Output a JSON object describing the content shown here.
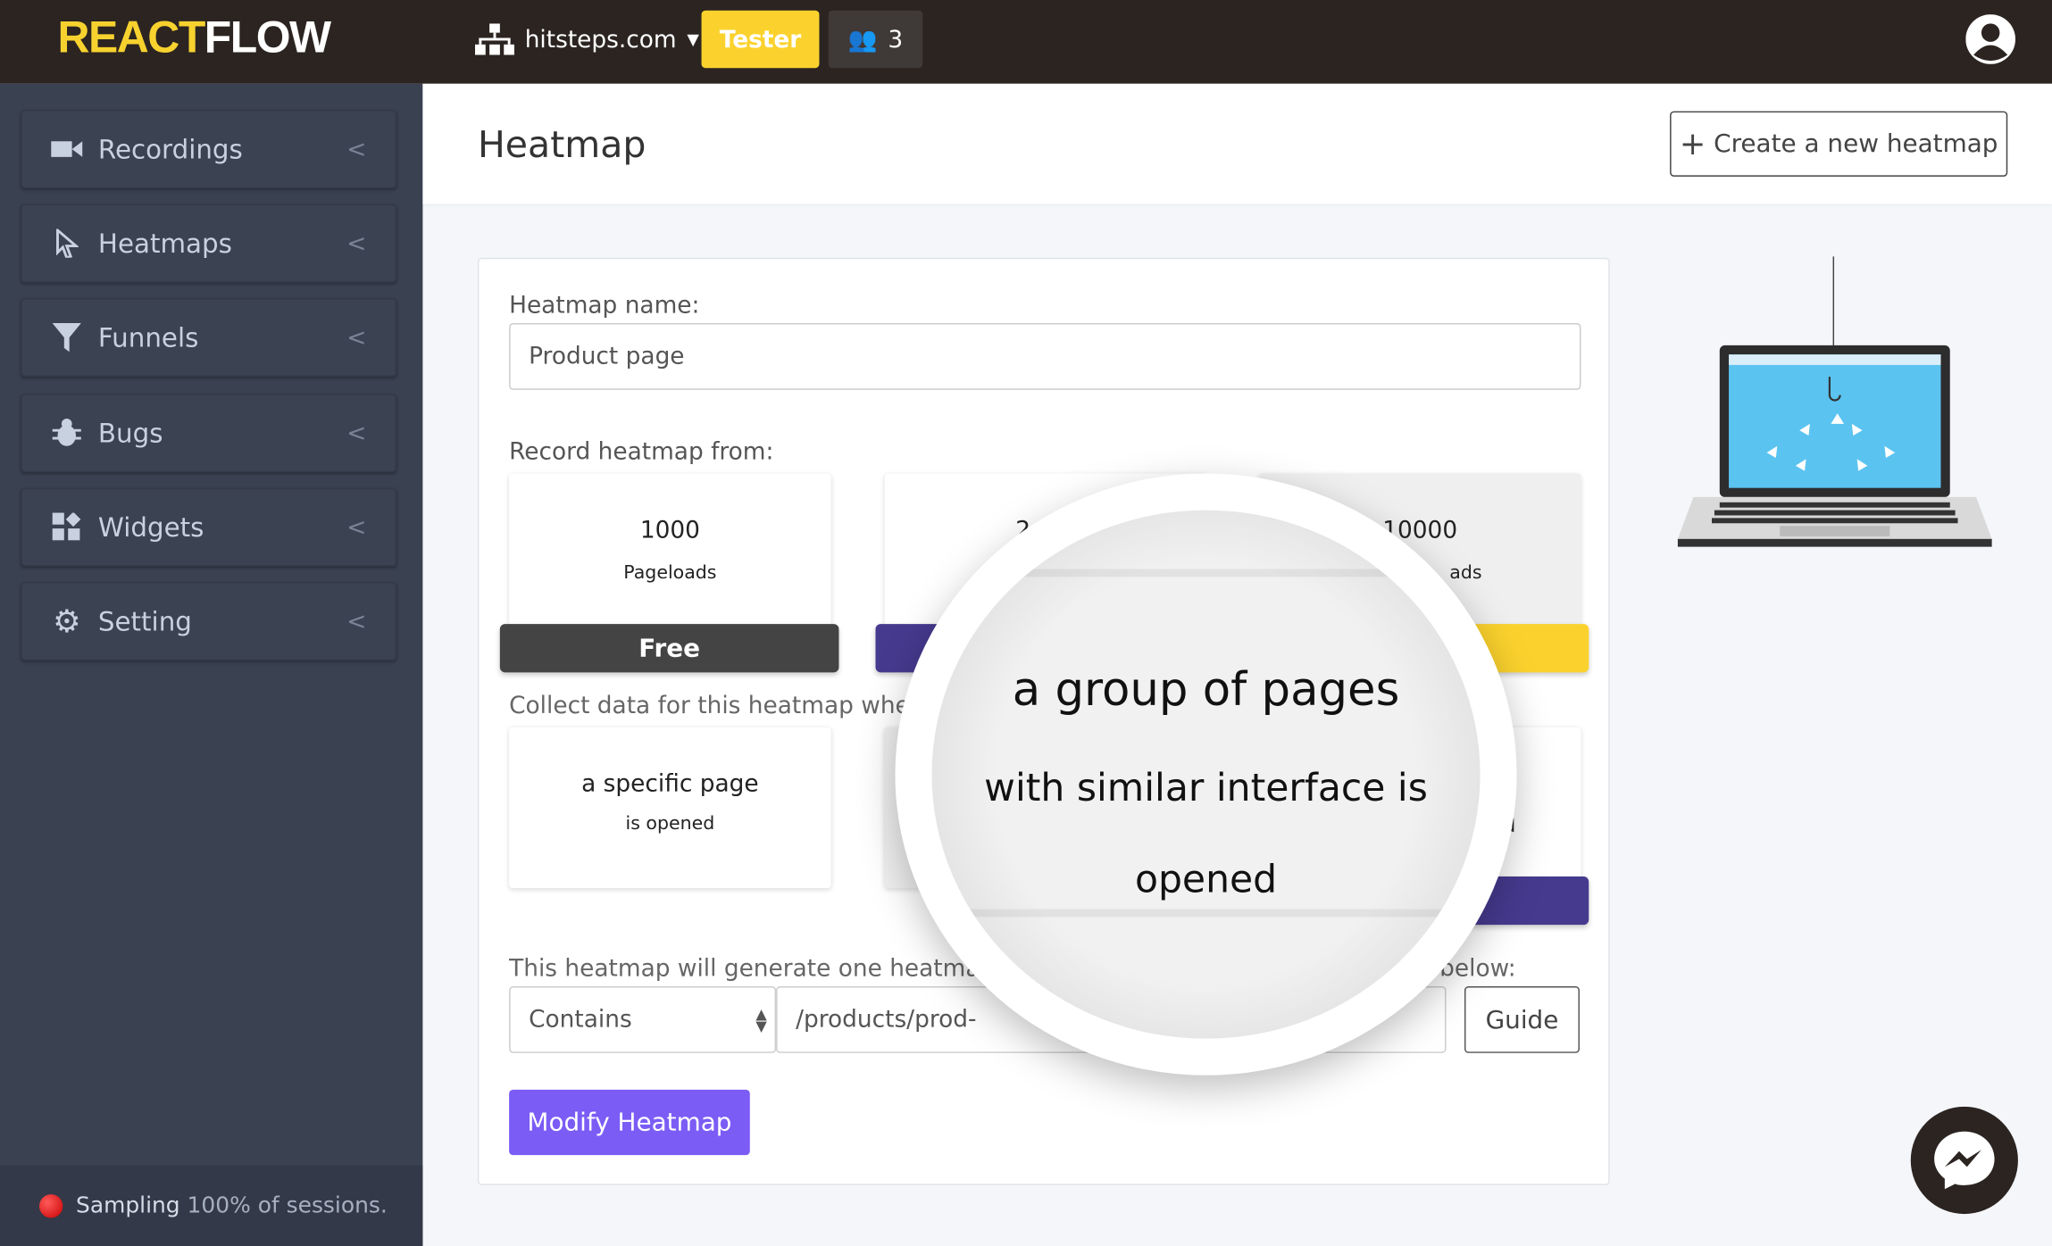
{
  "header": {
    "logo_a": "REACT",
    "logo_b": "FLOW",
    "site": "hitsteps.com",
    "tester": "Tester",
    "team_count": "3"
  },
  "sidebar": {
    "items": [
      {
        "label": "Recordings",
        "icon": "video-camera-icon"
      },
      {
        "label": "Heatmaps",
        "icon": "cursor-icon"
      },
      {
        "label": "Funnels",
        "icon": "funnel-icon"
      },
      {
        "label": "Bugs",
        "icon": "bug-icon"
      },
      {
        "label": "Widgets",
        "icon": "widgets-icon"
      },
      {
        "label": "Setting",
        "icon": "gear-icon"
      }
    ],
    "sampling_label": "Sampling",
    "sampling_value": "100% of sessions."
  },
  "page": {
    "title": "Heatmap",
    "create_button": "Create a new heatmap"
  },
  "form": {
    "name_label": "Heatmap name:",
    "name_value": "Product page",
    "record_label": "Record heatmap from:",
    "record_options": [
      {
        "value": "1000",
        "unit": "Pageloads",
        "button": "Free"
      },
      {
        "value": "2",
        "unit": ""
      },
      {
        "value": "10000",
        "unit": "ads"
      }
    ],
    "collect_label": "Collect data for this heatmap when:",
    "collect_options": [
      {
        "line1": "a specific page",
        "line2": "is opened"
      },
      {
        "line2": "d"
      }
    ],
    "generate_label_start": "This heatmap will generate one heatmap fo",
    "generate_label_end": "below:",
    "match_select": "Contains",
    "url_value": "/products/prod-",
    "guide_button": "Guide",
    "submit_button": "Modify Heatmap"
  },
  "magnifier": {
    "line1": "a group of pages",
    "line2": "with similar interface is",
    "line3": "opened"
  },
  "colors": {
    "accent": "#7b5cf5",
    "yellow": "#fbd22d",
    "purple": "#463a8f",
    "dark": "#2b2421"
  }
}
